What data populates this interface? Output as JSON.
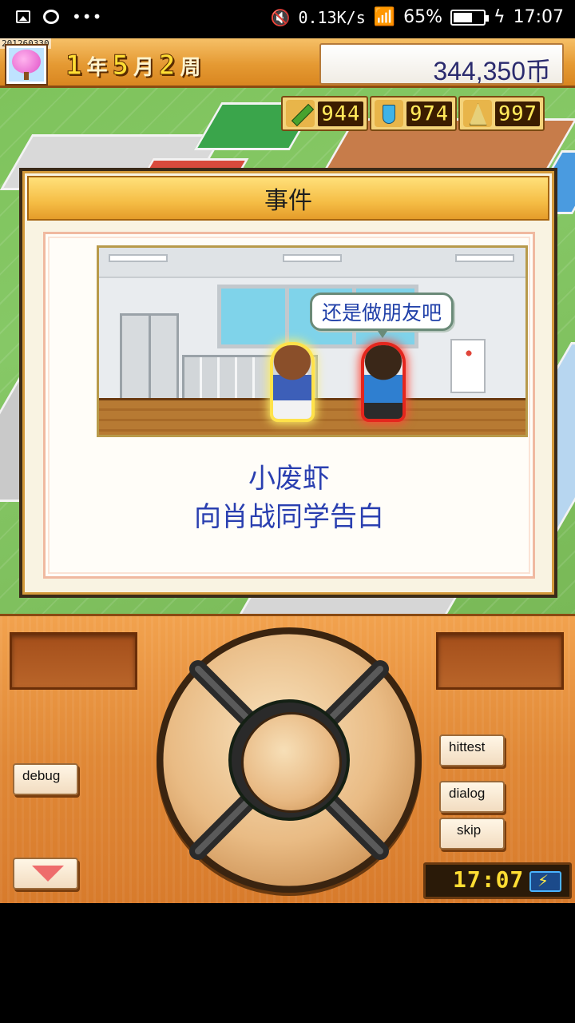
{
  "status_bar": {
    "net_speed": "0.13K/s",
    "battery": "65%",
    "battery_level": 0.65,
    "time": "17:07"
  },
  "hud": {
    "build_id": "201260330",
    "date": {
      "year_num": "1",
      "year_unit": "年",
      "month_num": "5",
      "month_unit": "月",
      "week_num": "2",
      "week_unit": "周"
    },
    "money": "344,350币"
  },
  "stats": [
    {
      "icon": "pencil-icon",
      "value": "944"
    },
    {
      "icon": "flask-icon",
      "value": "974"
    },
    {
      "icon": "trophy-icon",
      "value": "997"
    }
  ],
  "event": {
    "title": "事件",
    "speech_bubble": "还是做朋友吧",
    "message_line1": "小废虾",
    "message_line2": "向肖战同学告白"
  },
  "controls": {
    "debug": "debug",
    "hittest": "hittest",
    "dialog": "dialog",
    "skip": "skip",
    "clock": "17:07"
  },
  "colors": {
    "hud_orange": "#e59a33",
    "pad_orange": "#e08836",
    "message_blue": "#2a3fb0",
    "glow_yellow": "#ffe24a",
    "glow_red": "#e4261d"
  }
}
